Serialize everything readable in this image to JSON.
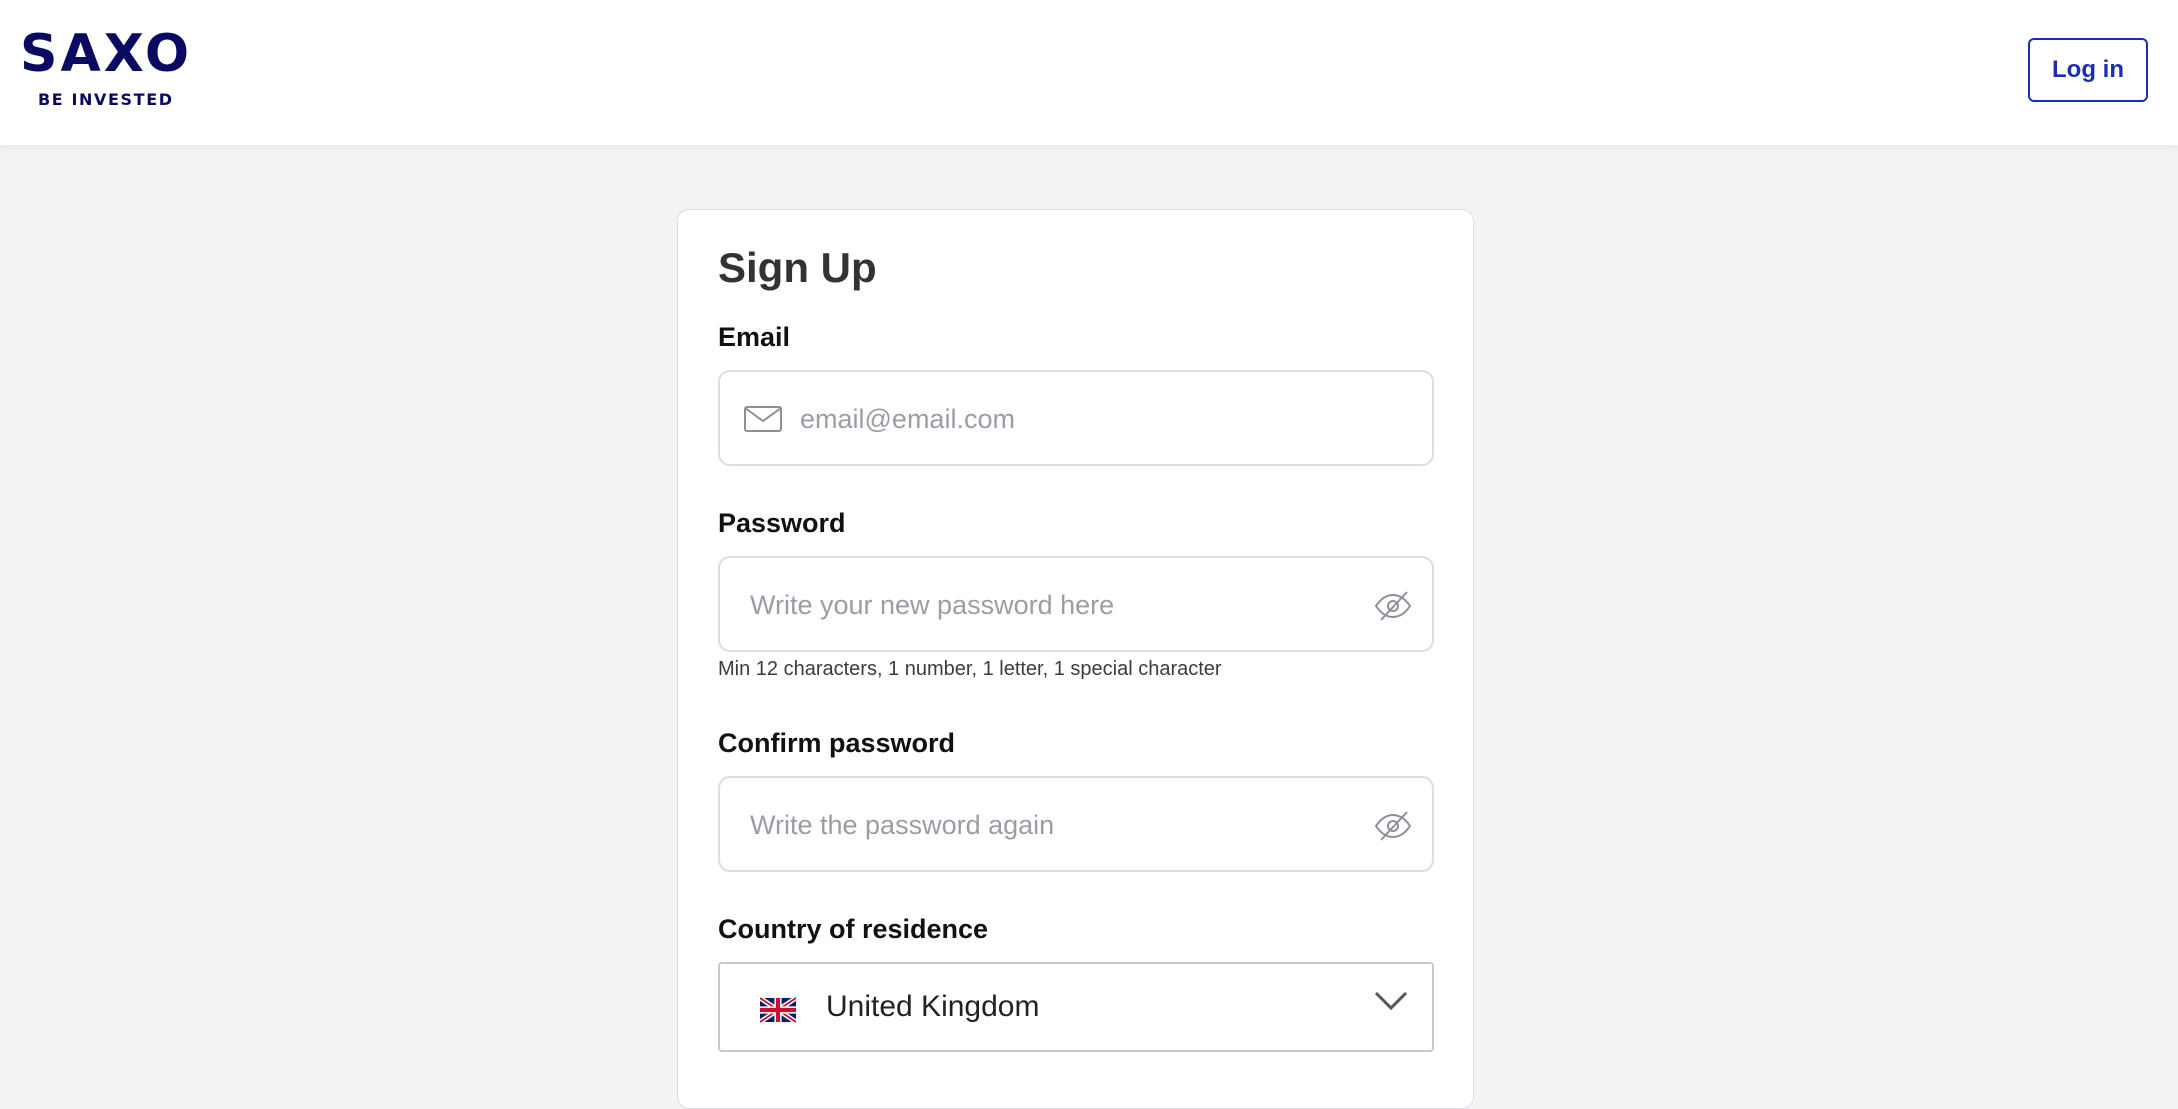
{
  "header": {
    "logo_word": "SAXO",
    "logo_tagline": "BE INVESTED",
    "login_label": "Log in"
  },
  "form": {
    "title": "Sign Up",
    "email": {
      "label": "Email",
      "placeholder": "email@email.com",
      "value": "",
      "icon": "mail-icon"
    },
    "password": {
      "label": "Password",
      "placeholder": "Write your new password here",
      "value": "",
      "hint": "Min 12 characters, 1 number, 1 letter, 1 special character",
      "icon": "eye-slash-icon"
    },
    "confirm_password": {
      "label": "Confirm password",
      "placeholder": "Write the password again",
      "value": "",
      "icon": "eye-slash-icon"
    },
    "country": {
      "label": "Country of residence",
      "selected": "United Kingdom",
      "flag_icon": "uk-flag-icon",
      "dropdown_icon": "chevron-down-icon"
    }
  },
  "colors": {
    "brand_navy": "#0b0a62",
    "link_blue": "#1a2fb0",
    "page_bg": "#f2f3f5",
    "placeholder": "#9a9da5"
  }
}
